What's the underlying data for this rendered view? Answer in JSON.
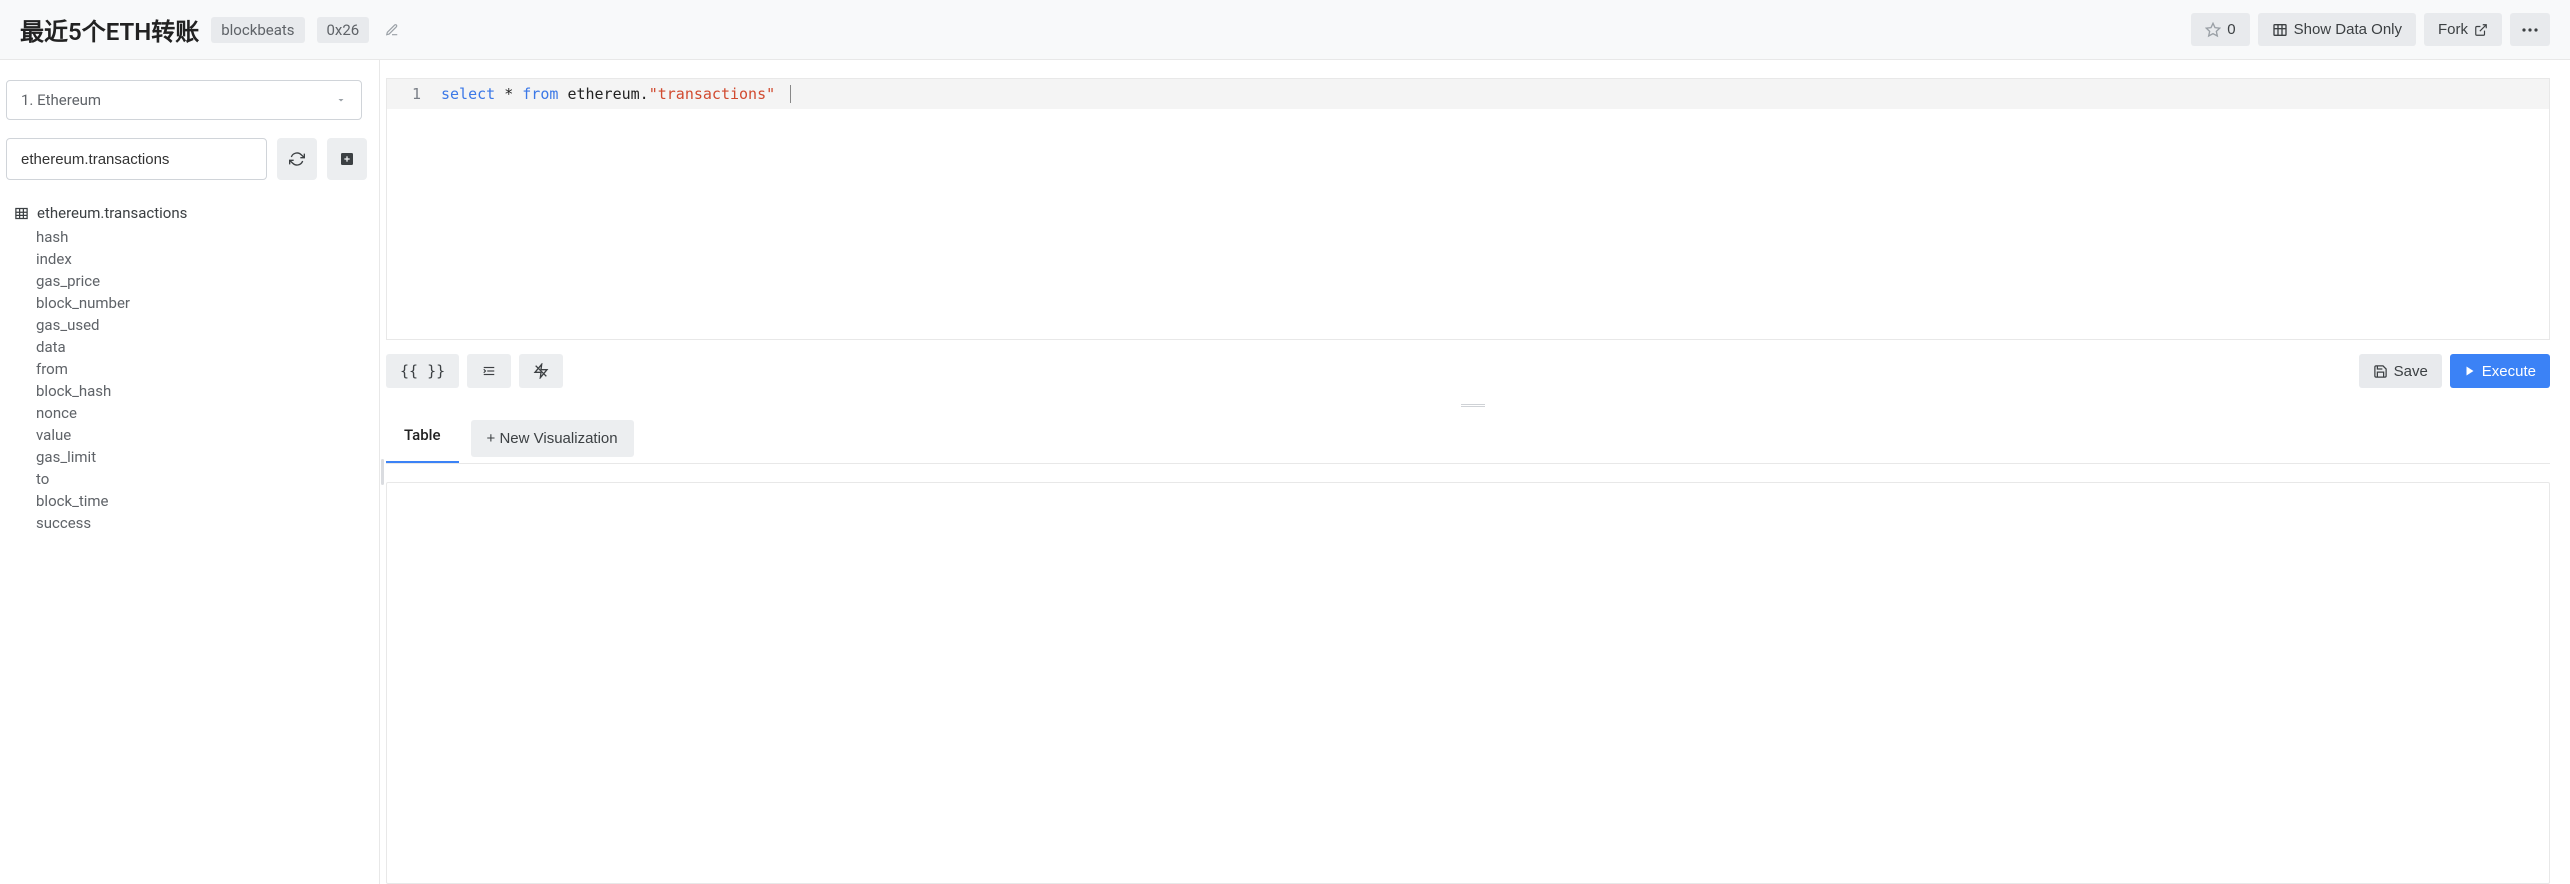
{
  "header": {
    "title": "最近5个ETH转账",
    "tags": [
      "blockbeats",
      "0x26"
    ],
    "star_count": "0",
    "show_data_label": "Show Data Only",
    "fork_label": "Fork"
  },
  "sidebar": {
    "dataset_selected": "1. Ethereum",
    "search_value": "ethereum.transactions",
    "table_name": "ethereum.transactions",
    "columns": [
      "hash",
      "index",
      "gas_price",
      "block_number",
      "gas_used",
      "data",
      "from",
      "block_hash",
      "nonce",
      "value",
      "gas_limit",
      "to",
      "block_time",
      "success"
    ]
  },
  "editor": {
    "line_number": "1",
    "tokens": {
      "select": "select",
      "star": "*",
      "from": "from",
      "schema": "ethereum.",
      "table": "\"transactions\""
    }
  },
  "toolbar": {
    "braces_label": "{{ }}",
    "save_label": "Save",
    "execute_label": "Execute"
  },
  "tabs": {
    "table_label": "Table",
    "new_viz_label": "+ New Visualization"
  }
}
